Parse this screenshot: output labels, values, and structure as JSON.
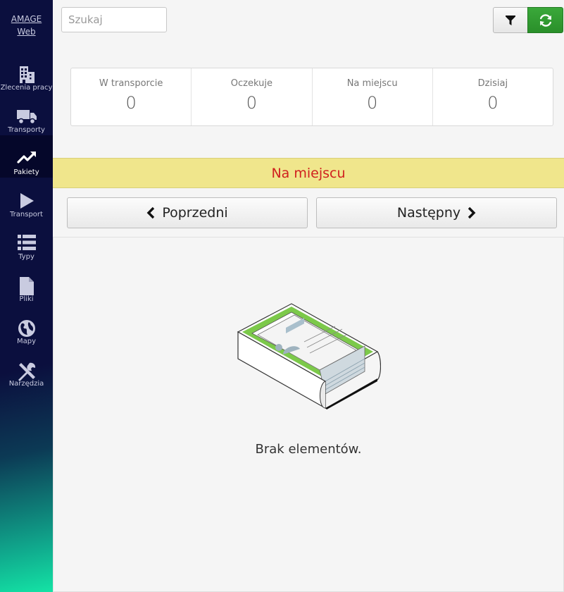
{
  "app": {
    "brand_line1": "AMAGE",
    "brand_line2": "Web"
  },
  "sidebar": {
    "items": [
      {
        "label": "Zlecenia pracy",
        "icon": "building-icon"
      },
      {
        "label": "Transporty",
        "icon": "truck-icon"
      },
      {
        "label": "Pakiety",
        "icon": "trend-up-icon",
        "active": true
      },
      {
        "label": "Transport",
        "icon": "play-icon"
      },
      {
        "label": "Typy",
        "icon": "list-icon"
      },
      {
        "label": "Pliki",
        "icon": "file-icon"
      },
      {
        "label": "Mapy",
        "icon": "globe-icon"
      },
      {
        "label": "Narzędzia",
        "icon": "tools-icon"
      }
    ]
  },
  "search": {
    "placeholder": "Szukaj",
    "value": ""
  },
  "toolbar": {
    "filter_icon": "filter-icon",
    "refresh_icon": "refresh-icon",
    "refresh_color": "#2f9a2f"
  },
  "stats": [
    {
      "label": "W transporcie",
      "value": "0"
    },
    {
      "label": "Oczekuje",
      "value": "0"
    },
    {
      "label": "Na miejscu",
      "value": "0"
    },
    {
      "label": "Dzisiaj",
      "value": "0"
    }
  ],
  "status": {
    "label": "Na miejscu",
    "background": "#f0e68c",
    "color": "#d0201f"
  },
  "pager": {
    "prev_label": "Poprzedni",
    "next_label": "Następny"
  },
  "empty": {
    "message": "Brak elementów.",
    "illustration": "empty-box-illustration"
  }
}
